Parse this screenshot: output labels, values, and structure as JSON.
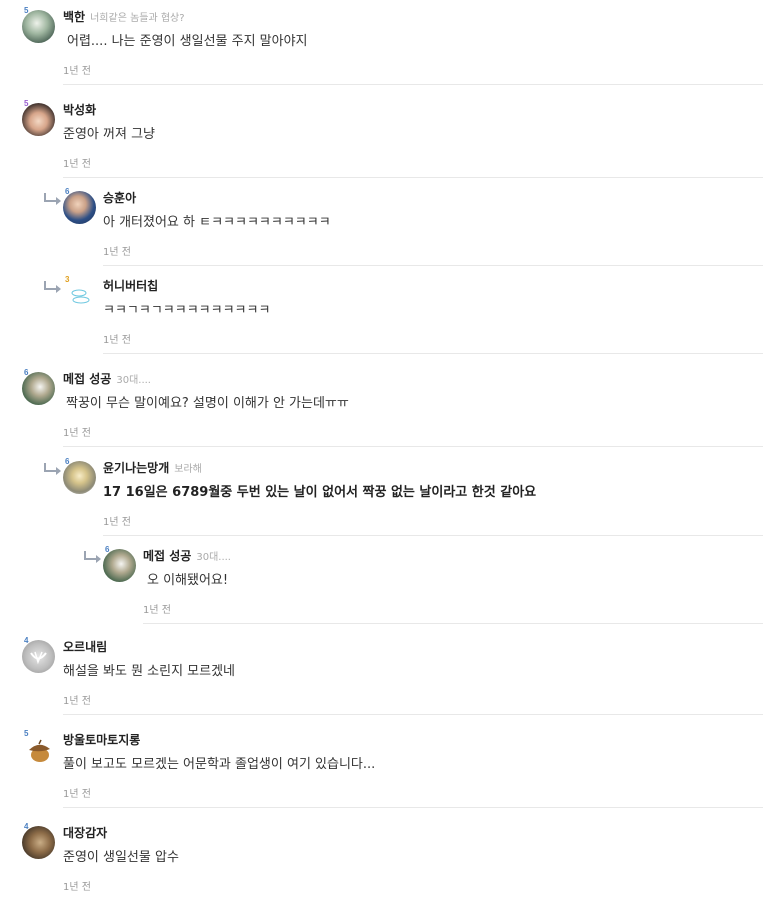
{
  "time_label": "1년 전",
  "comments": [
    {
      "id": "c1",
      "level": "5",
      "name": "백한",
      "sub": "너희같은 놈들과 협상?",
      "text": "어렵.... 나는 준영이 생일선물 주지 말아야지"
    },
    {
      "id": "c2",
      "level": "5",
      "name": "박성화",
      "sub": "",
      "text": "준영아 꺼져 그냥"
    },
    {
      "id": "c3",
      "level": "6",
      "name": "승훈아",
      "sub": "",
      "text": "아 개터졌어요 하 ㅌㅋㅋㅋㅋㅋㅋㅋㅋㅋㅋ"
    },
    {
      "id": "c4",
      "level": "3",
      "name": "허니버터칩",
      "sub": "",
      "text": "ㅋㅋㄱㅋㄱㅋㅋㅋㅋㅋㅋㅋㅋㅋ"
    },
    {
      "id": "c5",
      "level": "6",
      "name": "메접 성공",
      "sub": "30대....",
      "text": "짝꿍이 무슨 말이예요? 설명이 이해가 안 가는데ㅠㅠ"
    },
    {
      "id": "c6",
      "level": "6",
      "name": "윤기나는망개",
      "sub": "보라해",
      "text": "17 16일은 6789월중 두번 있는 날이 없어서 짝꿍 없는 날이라고 한것 같아요"
    },
    {
      "id": "c7",
      "level": "6",
      "name": "메접 성공",
      "sub": "30대....",
      "text": "오 이해됐어요!"
    },
    {
      "id": "c8",
      "level": "4",
      "name": "오르내림",
      "sub": "",
      "text": "해설을 봐도 뭔 소린지 모르겠네"
    },
    {
      "id": "c9",
      "level": "5",
      "name": "방울토마토지롱",
      "sub": "",
      "text": "풀이 보고도 모르겠는 어문학과 졸업생이 여기 있습니다..."
    },
    {
      "id": "c10",
      "level": "4",
      "name": "대장감자",
      "sub": "",
      "text": "준영이 생일선물 압수"
    }
  ]
}
